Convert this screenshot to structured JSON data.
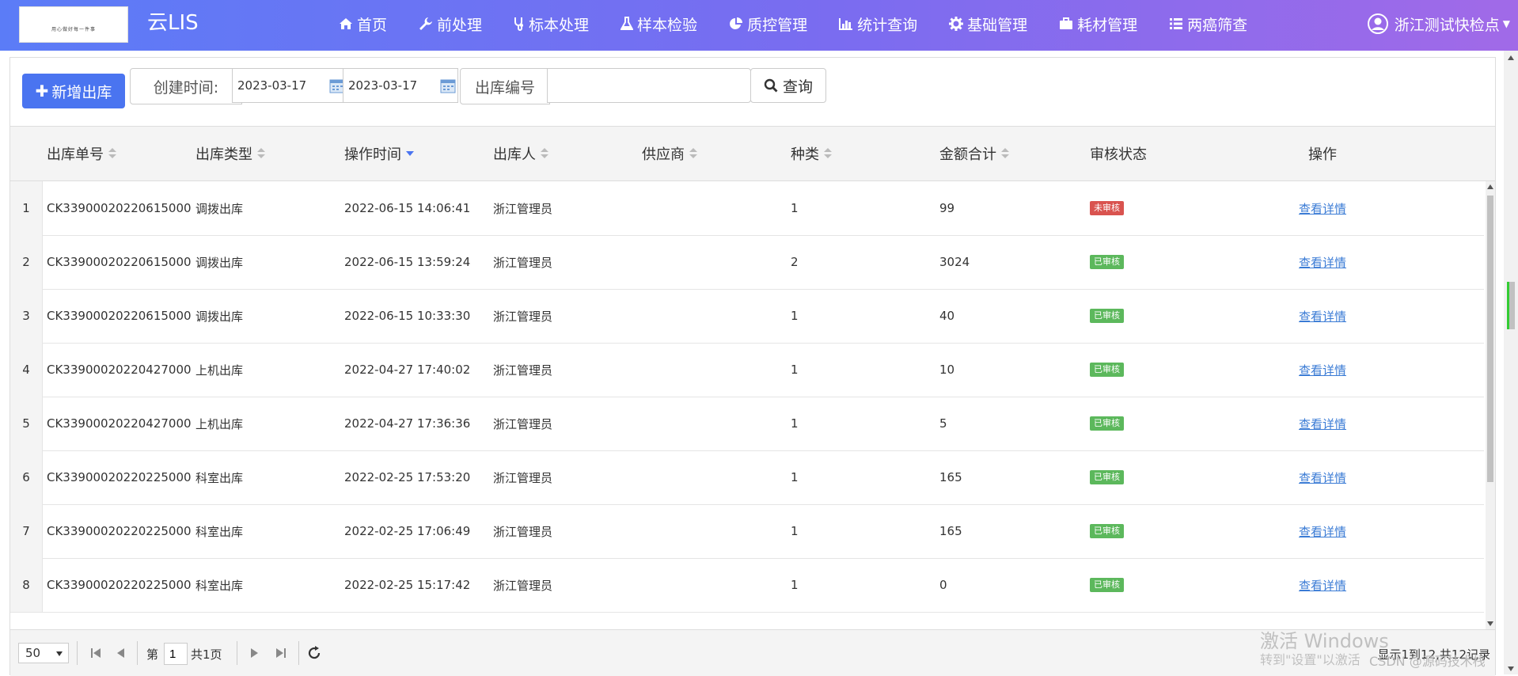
{
  "app": {
    "brand": "云LIS",
    "logo_slogan": "用心做好每一件事"
  },
  "nav": {
    "items": [
      {
        "label": "首页",
        "icon": "home-icon"
      },
      {
        "label": "前处理",
        "icon": "wrench-icon"
      },
      {
        "label": "标本处理",
        "icon": "stethoscope-icon"
      },
      {
        "label": "样本检验",
        "icon": "flask-icon"
      },
      {
        "label": "质控管理",
        "icon": "pie-chart-icon"
      },
      {
        "label": "统计查询",
        "icon": "bar-chart-icon"
      },
      {
        "label": "基础管理",
        "icon": "gear-icon"
      },
      {
        "label": "耗材管理",
        "icon": "briefcase-icon"
      },
      {
        "label": "两癌筛查",
        "icon": "list-icon"
      }
    ],
    "user": "浙江测试快检点"
  },
  "toolbar": {
    "add_label": "新增出库",
    "created_time_label": "创建时间:",
    "date_from": "2023-03-17",
    "date_sep": "-",
    "date_to": "2023-03-17",
    "order_no_label": "出库编号",
    "order_no_value": "",
    "query_label": "查询"
  },
  "table": {
    "columns": [
      "出库单号",
      "出库类型",
      "操作时间",
      "出库人",
      "供应商",
      "种类",
      "金额合计",
      "审核状态",
      "操作"
    ],
    "rows": [
      {
        "idx": "1",
        "no": "CK33900020220615000",
        "type": "调拨出库",
        "time": "2022-06-15 14:06:41",
        "operator": "浙江管理员",
        "supplier": "",
        "kinds": "1",
        "amount": "99",
        "status": "未审核",
        "action": "查看详情"
      },
      {
        "idx": "2",
        "no": "CK33900020220615000",
        "type": "调拨出库",
        "time": "2022-06-15 13:59:24",
        "operator": "浙江管理员",
        "supplier": "",
        "kinds": "2",
        "amount": "3024",
        "status": "已审核",
        "action": "查看详情"
      },
      {
        "idx": "3",
        "no": "CK33900020220615000",
        "type": "调拨出库",
        "time": "2022-06-15 10:33:30",
        "operator": "浙江管理员",
        "supplier": "",
        "kinds": "1",
        "amount": "40",
        "status": "已审核",
        "action": "查看详情"
      },
      {
        "idx": "4",
        "no": "CK33900020220427000",
        "type": "上机出库",
        "time": "2022-04-27 17:40:02",
        "operator": "浙江管理员",
        "supplier": "",
        "kinds": "1",
        "amount": "10",
        "status": "已审核",
        "action": "查看详情"
      },
      {
        "idx": "5",
        "no": "CK33900020220427000",
        "type": "上机出库",
        "time": "2022-04-27 17:36:36",
        "operator": "浙江管理员",
        "supplier": "",
        "kinds": "1",
        "amount": "5",
        "status": "已审核",
        "action": "查看详情"
      },
      {
        "idx": "6",
        "no": "CK33900020220225000",
        "type": "科室出库",
        "time": "2022-02-25 17:53:20",
        "operator": "浙江管理员",
        "supplier": "",
        "kinds": "1",
        "amount": "165",
        "status": "已审核",
        "action": "查看详情"
      },
      {
        "idx": "7",
        "no": "CK33900020220225000",
        "type": "科室出库",
        "time": "2022-02-25 17:06:49",
        "operator": "浙江管理员",
        "supplier": "",
        "kinds": "1",
        "amount": "165",
        "status": "已审核",
        "action": "查看详情"
      },
      {
        "idx": "8",
        "no": "CK33900020220225000",
        "type": "科室出库",
        "time": "2022-02-25 15:17:42",
        "operator": "浙江管理员",
        "supplier": "",
        "kinds": "1",
        "amount": "0",
        "status": "已审核",
        "action": "查看详情"
      }
    ],
    "status_colors": {
      "未审核": "#d9534f",
      "已审核": "#5cb85c"
    }
  },
  "pager": {
    "page_size": "50",
    "page_prefix": "第",
    "page_value": "1",
    "page_total": "共1页",
    "info": "显示1到12,共12记录"
  },
  "watermark": {
    "line1": "激活 Windows",
    "line2": "转到\"设置\"以激活",
    "line3": "CSDN @源码技术栈"
  },
  "colors": {
    "accent": "#4a74f0",
    "nav_gradient_start": "#5b7cf7",
    "nav_gradient_end": "#a16ae8"
  }
}
